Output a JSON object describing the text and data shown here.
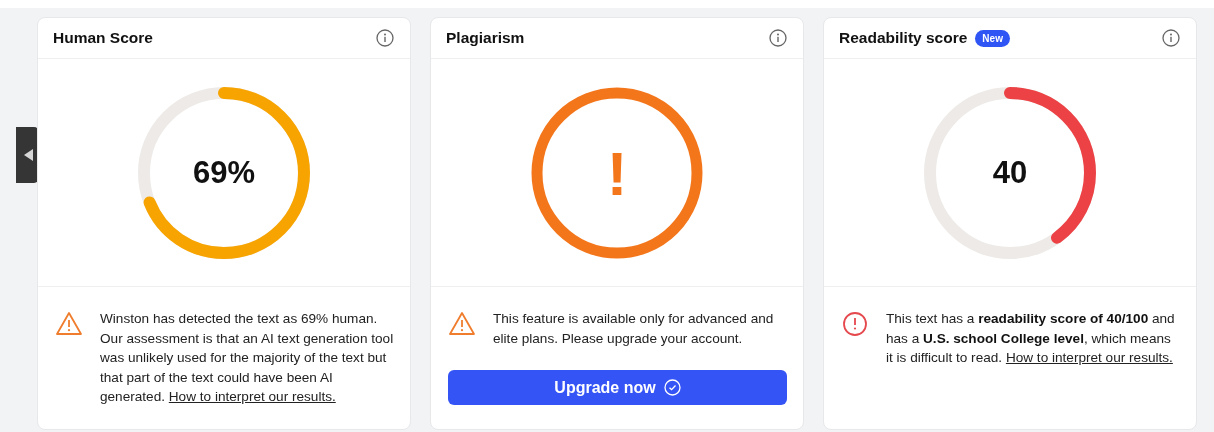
{
  "cards": [
    {
      "title": "Human Score",
      "gauge": {
        "kind": "score",
        "value": "69%",
        "level": 0.69,
        "color": "#f7a400"
      },
      "notice": {
        "kind": "warning",
        "text": "Winston has detected the text as 69% human. Our assessment is that an AI text generation tool was unlikely used for the majority of the text but that part of the text could have been AI generated.",
        "link": "How to interpret our results."
      }
    },
    {
      "title": "Plagiarism",
      "gauge": {
        "kind": "alert",
        "value": "!",
        "color": "#f4761b"
      },
      "notice": {
        "kind": "warning",
        "text": "This feature is available only for advanced and elite plans. Please upgrade your account."
      },
      "button": {
        "label": "Upgrade now"
      }
    },
    {
      "title": "Readability score",
      "badge": "New",
      "gauge": {
        "kind": "score",
        "value": "40",
        "level": 0.4,
        "color": "#ec4245"
      },
      "notice": {
        "kind": "error",
        "text": "This text has a **readability score of 40/100** and has a **U.S. school College level**, which means it is difficult to read.",
        "link": "How to interpret our results."
      }
    }
  ]
}
